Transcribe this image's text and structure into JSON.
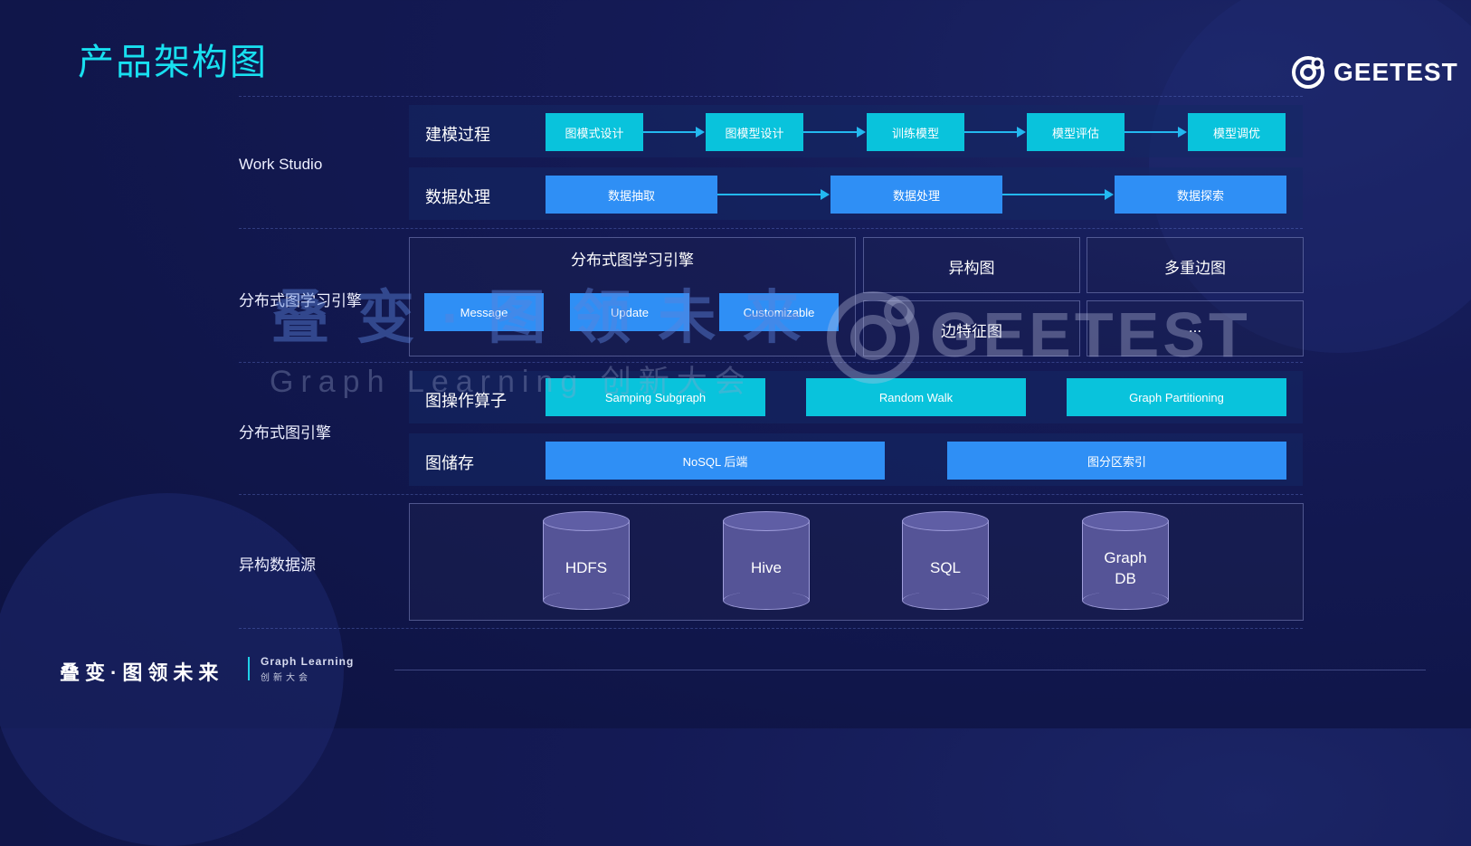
{
  "title": "产品架构图",
  "logo": {
    "text": "GEETEST"
  },
  "layers": [
    {
      "id": "work_studio",
      "label": "Work Studio"
    },
    {
      "id": "dist_gl",
      "label": "分布式图学习引擎"
    },
    {
      "id": "dist_graph",
      "label": "分布式图引擎"
    },
    {
      "id": "sources",
      "label": "异构数据源"
    }
  ],
  "work_studio": {
    "modeling": {
      "label": "建模过程",
      "steps": [
        "图模式设计",
        "图模型设计",
        "训练模型",
        "模型评估",
        "模型调优"
      ]
    },
    "data": {
      "label": "数据处理",
      "steps": [
        "数据抽取",
        "数据处理",
        "数据探索"
      ]
    }
  },
  "gl_engine": {
    "title": "分布式图学习引擎",
    "boxes": [
      "Message",
      "Update",
      "Customizable"
    ],
    "features": [
      "异构图",
      "多重边图",
      "边特征图",
      "..."
    ]
  },
  "graph_engine": {
    "operators": {
      "label": "图操作算子",
      "items": [
        "Samping Subgraph",
        "Random Walk",
        "Graph Partitioning"
      ]
    },
    "storage": {
      "label": "图储存",
      "items": [
        "NoSQL 后端",
        "图分区索引"
      ]
    }
  },
  "data_sources": {
    "items": [
      "HDFS",
      "Hive",
      "SQL",
      "Graph DB"
    ]
  },
  "watermark": {
    "cn": "叠变·图领未来",
    "en": "Graph Learning 创新大会",
    "logo": "GEETEST"
  },
  "footer": {
    "cn": "叠变·图领未来",
    "en": "Graph Learning",
    "en_sub": "创新大会"
  }
}
